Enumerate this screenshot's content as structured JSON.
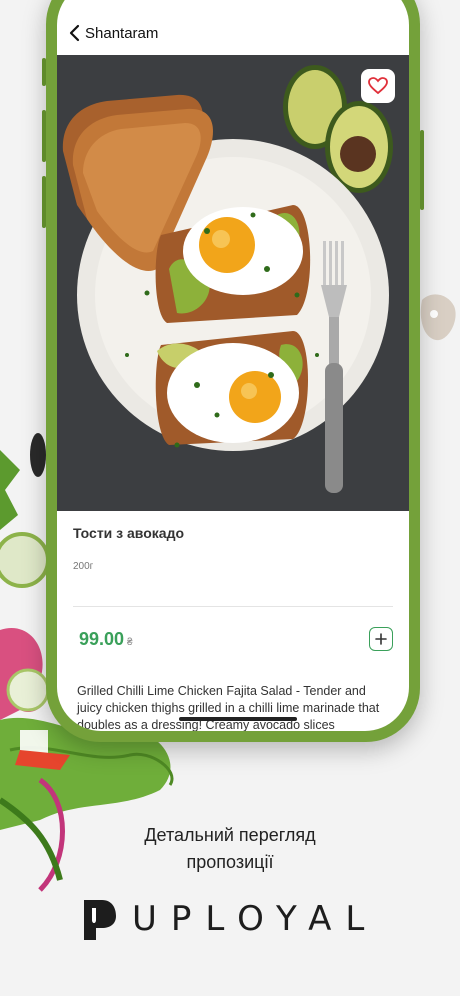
{
  "header": {
    "title": "Shantaram"
  },
  "product": {
    "name": "Тости з авокадо",
    "weight": "200г",
    "price": "99.00",
    "currency": "₴",
    "description": "Grilled Chilli Lime Chicken Fajita Salad - Tender and juicy chicken thighs grilled in a chilli lime marinade that doubles as a dressing! Creamy avocado slices"
  },
  "caption": {
    "line1": "Детальний перегляд",
    "line2": "пропозиції"
  },
  "brand": {
    "name": "UPLOYAL"
  },
  "colors": {
    "frame": "#74a13a",
    "accent": "#3aa05a",
    "favorite": "#e0303a"
  }
}
